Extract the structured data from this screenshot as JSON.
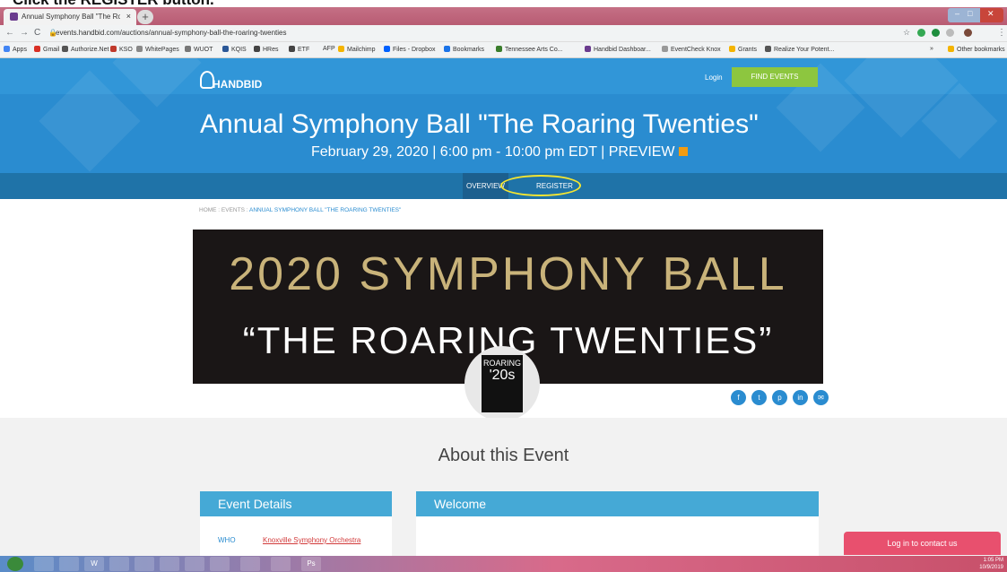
{
  "instruction": "Click the REGISTER button.",
  "browser": {
    "tab_title": "Annual Symphony Ball \"The Roar",
    "tab_close": "×",
    "new_tab": "+",
    "url": "events.handbid.com/auctions/annual-symphony-ball-the-roaring-twenties",
    "bookmarks": [
      "Apps",
      "Gmail",
      "Authorize.Net",
      "KSO",
      "WhitePages",
      "WUOT",
      "KQIS",
      "HRes",
      "ETF",
      "AFP",
      "Mailchimp",
      "Files - Dropbox",
      "Bookmarks",
      "Tennessee Arts Co...",
      "Handbid Dashboar...",
      "EventCheck Knox",
      "Grants",
      "Realize Your Potent...",
      "»",
      "Other bookmarks"
    ]
  },
  "site": {
    "logo": "HANDBID",
    "login": "Login",
    "find_events": "FIND EVENTS",
    "event_title": "Annual Symphony Ball \"The Roaring Twenties\"",
    "event_date": "February 29, 2020 | 6:00 pm - 10:00 pm EDT | PREVIEW",
    "nav_overview": "OVERVIEW",
    "nav_register": "REGISTER",
    "breadcrumb_prefix": "HOME : EVENTS : ",
    "breadcrumb_current": "ANNUAL SYMPHONY BALL \"THE ROARING TWENTIES\"",
    "banner_line1": "2020 SYMPHONY BALL",
    "banner_line2": "“THE ROARING TWENTIES”",
    "badge_top": "ROARING",
    "badge_bottom": "'20s",
    "social": [
      "f",
      "t",
      "p",
      "in",
      "✉"
    ],
    "about_title": "About this Event",
    "event_details": "Event Details",
    "welcome": "Welcome",
    "who_label": "WHO",
    "who_value": "Knoxville Symphony Orchestra",
    "contact_button": "Log in to contact us"
  },
  "taskbar": {
    "time": "1:05 PM",
    "date": "10/9/2019"
  }
}
